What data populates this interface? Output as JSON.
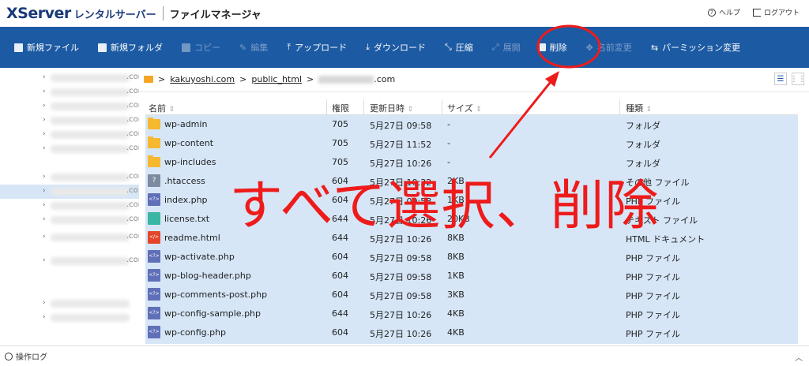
{
  "header": {
    "logo_x": "XServer",
    "logo_sub": "レンタルサーバー",
    "app_title": "ファイルマネージャ",
    "help_label": "ヘルプ",
    "logout_label": "ログアウト"
  },
  "toolbar": {
    "new_file": "新規ファイル",
    "new_folder": "新規フォルダ",
    "copy": "コピー",
    "edit": "編集",
    "upload": "アップロード",
    "download": "ダウンロード",
    "compress": "圧縮",
    "extract": "展開",
    "delete": "削除",
    "rename": "名前変更",
    "permission": "パーミッション変更"
  },
  "breadcrumb": {
    "root": "kakuyoshi.com",
    "dir": "public_html",
    "current_suffix": ".com"
  },
  "sidebar": {
    "tails": [
      ".com",
      ".com",
      ".com",
      ".com",
      ".com",
      ".com",
      ".com",
      ".co",
      ".com",
      ".com",
      ".com",
      ".com"
    ]
  },
  "table": {
    "columns": {
      "name": "名前",
      "perm": "権限",
      "modified": "更新日時",
      "size": "サイズ",
      "type": "種類"
    },
    "rows": [
      {
        "name": "wp-admin",
        "perm": "705",
        "modified": "5月27日 09:58",
        "size": "-",
        "type": "フォルダ",
        "icon": "folder"
      },
      {
        "name": "wp-content",
        "perm": "705",
        "modified": "5月27日 11:52",
        "size": "-",
        "type": "フォルダ",
        "icon": "folder"
      },
      {
        "name": "wp-includes",
        "perm": "705",
        "modified": "5月27日 10:26",
        "size": "-",
        "type": "フォルダ",
        "icon": "folder"
      },
      {
        "name": ".htaccess",
        "perm": "604",
        "modified": "5月27日 10:32",
        "size": "2KB",
        "type": "その他 ファイル",
        "icon": "other"
      },
      {
        "name": "index.php",
        "perm": "604",
        "modified": "5月27日 09:58",
        "size": "1KB",
        "type": "PHP ファイル",
        "icon": "php"
      },
      {
        "name": "license.txt",
        "perm": "644",
        "modified": "5月27日 10:26",
        "size": "20KB",
        "type": "テキスト ファイル",
        "icon": "txt"
      },
      {
        "name": "readme.html",
        "perm": "644",
        "modified": "5月27日 10:26",
        "size": "8KB",
        "type": "HTML ドキュメント",
        "icon": "html"
      },
      {
        "name": "wp-activate.php",
        "perm": "604",
        "modified": "5月27日 09:58",
        "size": "8KB",
        "type": "PHP ファイル",
        "icon": "php"
      },
      {
        "name": "wp-blog-header.php",
        "perm": "604",
        "modified": "5月27日 09:58",
        "size": "1KB",
        "type": "PHP ファイル",
        "icon": "php"
      },
      {
        "name": "wp-comments-post.php",
        "perm": "604",
        "modified": "5月27日 09:58",
        "size": "3KB",
        "type": "PHP ファイル",
        "icon": "php"
      },
      {
        "name": "wp-config-sample.php",
        "perm": "644",
        "modified": "5月27日 10:26",
        "size": "4KB",
        "type": "PHP ファイル",
        "icon": "php"
      },
      {
        "name": "wp-config.php",
        "perm": "604",
        "modified": "5月27日 10:26",
        "size": "4KB",
        "type": "PHP ファイル",
        "icon": "php"
      }
    ]
  },
  "bottom": {
    "log_label": "操作ログ"
  },
  "annotation": {
    "text": "すべて選択、削除",
    "color": "#ee1b1b"
  },
  "colors": {
    "toolbar_bg": "#1c5aa3",
    "selected_row_bg": "#d6e6f7",
    "folder": "#f5b82e"
  }
}
